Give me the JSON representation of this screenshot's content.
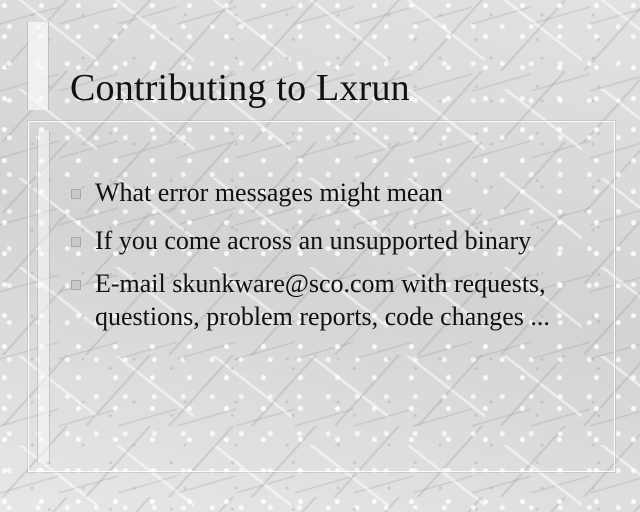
{
  "slide": {
    "title": "Contributing to Lxrun",
    "bullets": [
      {
        "text": "What error messages might mean"
      },
      {
        "text": "If you come across an unsupported binary"
      },
      {
        "text": "E-mail skunkware@sco.com with requests, questions, problem reports, code changes ..."
      }
    ]
  },
  "colors": {
    "background": "#dcdcdc",
    "text": "#111111",
    "bullet_marker": "#c9c9c9"
  }
}
